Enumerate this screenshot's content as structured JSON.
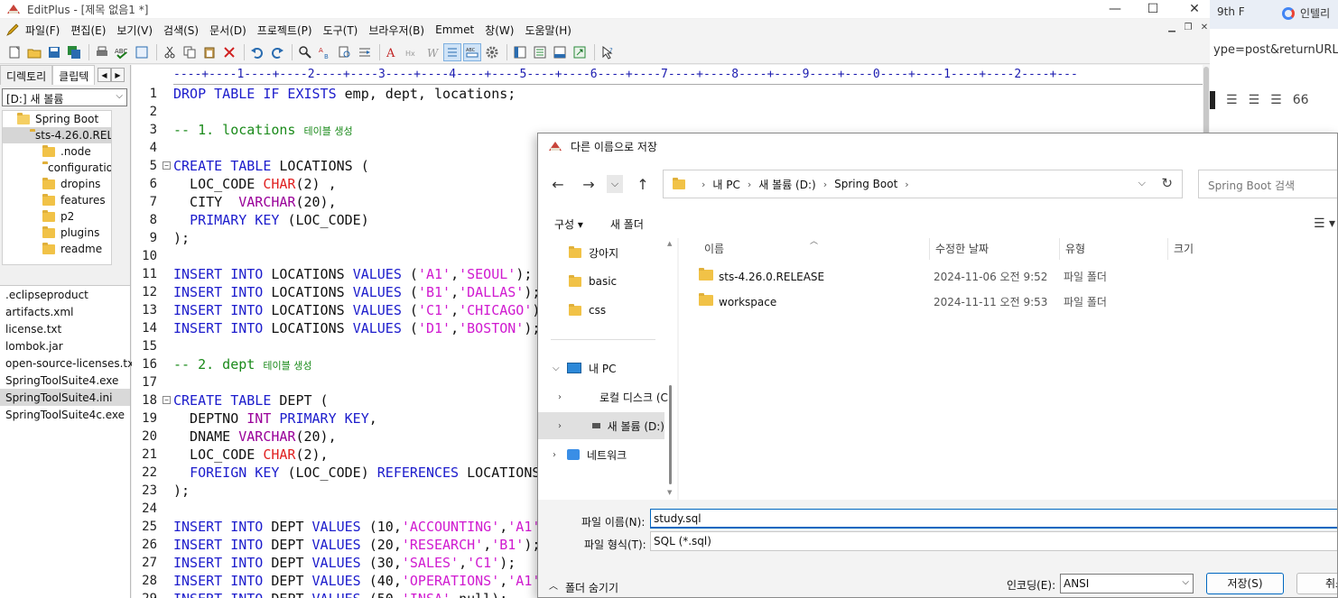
{
  "editplus": {
    "title": "EditPlus - [제목 없음1 *]",
    "menu": [
      "파일(F)",
      "편집(E)",
      "보기(V)",
      "검색(S)",
      "문서(D)",
      "프로젝트(P)",
      "도구(T)",
      "브라우저(B)",
      "Emmet",
      "창(W)",
      "도움말(H)"
    ],
    "left_tabs": [
      "디렉토리",
      "클립텍"
    ],
    "drive": "[D:] 새 볼륨",
    "tree": [
      {
        "label": "Spring Boot",
        "indent": 0,
        "open": true
      },
      {
        "label": "sts-4.26.0.REL",
        "indent": 1,
        "open": true,
        "selected": true
      },
      {
        "label": ".node",
        "indent": 2
      },
      {
        "label": "configuration",
        "indent": 2
      },
      {
        "label": "dropins",
        "indent": 2
      },
      {
        "label": "features",
        "indent": 2
      },
      {
        "label": "p2",
        "indent": 2
      },
      {
        "label": "plugins",
        "indent": 2
      },
      {
        "label": "readme",
        "indent": 2
      }
    ],
    "files": [
      ".eclipseproduct",
      "artifacts.xml",
      "license.txt",
      "lombok.jar",
      "open-source-licenses.txt",
      "SpringToolSuite4.exe",
      "SpringToolSuite4.ini",
      "SpringToolSuite4c.exe"
    ],
    "selected_file": "SpringToolSuite4.ini",
    "ruler": "----+----1----+----2----+----3----+----4----+----5----+----6----+----7----+----8----+----9----+----0----+----1----+----2----+---",
    "lines": [
      {
        "n": 1,
        "tokens": [
          [
            "kw",
            "DROP TABLE IF EXISTS"
          ],
          [
            "",
            "emp, dept, locations;"
          ]
        ]
      },
      {
        "n": 2,
        "tokens": []
      },
      {
        "n": 3,
        "tokens": [
          [
            "cm",
            "-- 1. locations "
          ],
          [
            "cmk",
            "테이블 생성"
          ]
        ]
      },
      {
        "n": 4,
        "tokens": []
      },
      {
        "n": 5,
        "fold": true,
        "tokens": [
          [
            "kw",
            "CREATE TABLE"
          ],
          [
            "",
            "LOCATIONS ("
          ]
        ]
      },
      {
        "n": 6,
        "tokens": [
          [
            "",
            "  LOC_CODE "
          ],
          [
            "ty",
            "CHAR"
          ],
          [
            "",
            "(2) ,"
          ]
        ]
      },
      {
        "n": 7,
        "tokens": [
          [
            "",
            "  CITY  "
          ],
          [
            "ty2",
            "VARCHAR"
          ],
          [
            "",
            "(20),"
          ]
        ]
      },
      {
        "n": 8,
        "tokens": [
          [
            "",
            "  "
          ],
          [
            "kw",
            "PRIMARY KEY"
          ],
          [
            "",
            "(LOC_CODE)"
          ]
        ]
      },
      {
        "n": 9,
        "tokens": [
          [
            "",
            ");"
          ]
        ]
      },
      {
        "n": 10,
        "tokens": []
      },
      {
        "n": 11,
        "tokens": [
          [
            "kw",
            "INSERT INTO"
          ],
          [
            "",
            "LOCATIONS "
          ],
          [
            "kw",
            "VALUES"
          ],
          [
            "",
            "("
          ],
          [
            "st",
            "'A1'"
          ],
          [
            "",
            ","
          ],
          [
            "st",
            "'SEOUL'"
          ],
          [
            "",
            ");"
          ]
        ]
      },
      {
        "n": 12,
        "tokens": [
          [
            "kw",
            "INSERT INTO"
          ],
          [
            "",
            "LOCATIONS "
          ],
          [
            "kw",
            "VALUES"
          ],
          [
            "",
            "("
          ],
          [
            "st",
            "'B1'"
          ],
          [
            "",
            ","
          ],
          [
            "st",
            "'DALLAS'"
          ],
          [
            "",
            ");"
          ]
        ]
      },
      {
        "n": 13,
        "tokens": [
          [
            "kw",
            "INSERT INTO"
          ],
          [
            "",
            "LOCATIONS "
          ],
          [
            "kw",
            "VALUES"
          ],
          [
            "",
            "("
          ],
          [
            "st",
            "'C1'"
          ],
          [
            "",
            ","
          ],
          [
            "st",
            "'CHICAGO'"
          ],
          [
            "",
            ");"
          ]
        ]
      },
      {
        "n": 14,
        "tokens": [
          [
            "kw",
            "INSERT INTO"
          ],
          [
            "",
            "LOCATIONS "
          ],
          [
            "kw",
            "VALUES"
          ],
          [
            "",
            "("
          ],
          [
            "st",
            "'D1'"
          ],
          [
            "",
            ","
          ],
          [
            "st",
            "'BOSTON'"
          ],
          [
            "",
            ");"
          ]
        ]
      },
      {
        "n": 15,
        "tokens": []
      },
      {
        "n": 16,
        "tokens": [
          [
            "cm",
            "-- 2. dept "
          ],
          [
            "cmk",
            "테이블 생성"
          ]
        ]
      },
      {
        "n": 17,
        "tokens": []
      },
      {
        "n": 18,
        "fold": true,
        "tokens": [
          [
            "kw",
            "CREATE TABLE"
          ],
          [
            "",
            "DEPT ("
          ]
        ]
      },
      {
        "n": 19,
        "tokens": [
          [
            "",
            "  DEPTNO "
          ],
          [
            "ty2",
            "INT"
          ],
          [
            "",
            ""
          ],
          [
            "kw",
            "PRIMARY KEY"
          ],
          [
            "",
            ","
          ]
        ]
      },
      {
        "n": 20,
        "tokens": [
          [
            "",
            "  DNAME "
          ],
          [
            "ty2",
            "VARCHAR"
          ],
          [
            "",
            "(20),"
          ]
        ]
      },
      {
        "n": 21,
        "tokens": [
          [
            "",
            "  LOC_CODE "
          ],
          [
            "ty",
            "CHAR"
          ],
          [
            "",
            "(2),"
          ]
        ]
      },
      {
        "n": 22,
        "tokens": [
          [
            "",
            "  "
          ],
          [
            "kw",
            "FOREIGN KEY"
          ],
          [
            "",
            "(LOC_CODE) "
          ],
          [
            "kw",
            "REFERENCES"
          ],
          [
            "",
            "LOCATIONS"
          ]
        ]
      },
      {
        "n": 23,
        "tokens": [
          [
            "",
            ");"
          ]
        ]
      },
      {
        "n": 24,
        "tokens": []
      },
      {
        "n": 25,
        "tokens": [
          [
            "kw",
            "INSERT INTO"
          ],
          [
            "",
            "DEPT "
          ],
          [
            "kw",
            "VALUES"
          ],
          [
            "",
            "(10,"
          ],
          [
            "st",
            "'ACCOUNTING'"
          ],
          [
            "",
            ","
          ],
          [
            "st",
            "'A1'"
          ]
        ]
      },
      {
        "n": 26,
        "tokens": [
          [
            "kw",
            "INSERT INTO"
          ],
          [
            "",
            "DEPT "
          ],
          [
            "kw",
            "VALUES"
          ],
          [
            "",
            "(20,"
          ],
          [
            "st",
            "'RESEARCH'"
          ],
          [
            "",
            ","
          ],
          [
            "st",
            "'B1'"
          ],
          [
            "",
            ");"
          ]
        ]
      },
      {
        "n": 27,
        "tokens": [
          [
            "kw",
            "INSERT INTO"
          ],
          [
            "",
            "DEPT "
          ],
          [
            "kw",
            "VALUES"
          ],
          [
            "",
            "(30,"
          ],
          [
            "st",
            "'SALES'"
          ],
          [
            "",
            ","
          ],
          [
            "st",
            "'C1'"
          ],
          [
            "",
            ");"
          ]
        ]
      },
      {
        "n": 28,
        "tokens": [
          [
            "kw",
            "INSERT INTO"
          ],
          [
            "",
            "DEPT "
          ],
          [
            "kw",
            "VALUES"
          ],
          [
            "",
            "(40,"
          ],
          [
            "st",
            "'OPERATIONS'"
          ],
          [
            "",
            ","
          ],
          [
            "st",
            "'A1'"
          ]
        ]
      },
      {
        "n": 29,
        "tokens": [
          [
            "kw",
            "INSERT INTO"
          ],
          [
            "",
            "DEPT "
          ],
          [
            "kw",
            "VALUES"
          ],
          [
            "",
            "(50,"
          ],
          [
            "st",
            "'INSA'"
          ],
          [
            "",
            ",null);"
          ]
        ]
      }
    ]
  },
  "browser": {
    "tab1": "9th F",
    "tab2": "인텔리",
    "url": "ype=post&returnURL=",
    "toolbar_num": "66"
  },
  "dialog": {
    "title": "다른 이름으로 저장",
    "breadcrumb": [
      "내 PC",
      "새 볼륨 (D:)",
      "Spring Boot"
    ],
    "search_placeholder": "Spring Boot 검색",
    "organize": "구성 ▾",
    "new_folder": "새 폴더",
    "nav": [
      {
        "label": "강아지",
        "kind": "folder"
      },
      {
        "label": "basic",
        "kind": "folder"
      },
      {
        "label": "css",
        "kind": "folder"
      },
      {
        "label": "내 PC",
        "kind": "pc",
        "expanded": true
      },
      {
        "label": "로컬 디스크 (C",
        "kind": "disk"
      },
      {
        "label": "새 볼륨 (D:)",
        "kind": "drive",
        "selected": true
      },
      {
        "label": "네트워크",
        "kind": "net"
      }
    ],
    "columns": [
      "이름",
      "수정한 날짜",
      "유형",
      "크기"
    ],
    "rows": [
      {
        "name": "sts-4.26.0.RELEASE",
        "date": "2024-11-06 오전 9:52",
        "type": "파일 폴더",
        "size": ""
      },
      {
        "name": "workspace",
        "date": "2024-11-11 오전 9:53",
        "type": "파일 폴더",
        "size": ""
      }
    ],
    "filename_label": "파일 이름(N):",
    "filename_value": "study.sql",
    "filetype_label": "파일 형식(T):",
    "filetype_value": "SQL (*.sql)",
    "hide_folders": "폴더 숨기기",
    "encoding_label": "인코딩(E):",
    "encoding_value": "ANSI",
    "save_button": "저장(S)",
    "cancel_button": "취소"
  }
}
